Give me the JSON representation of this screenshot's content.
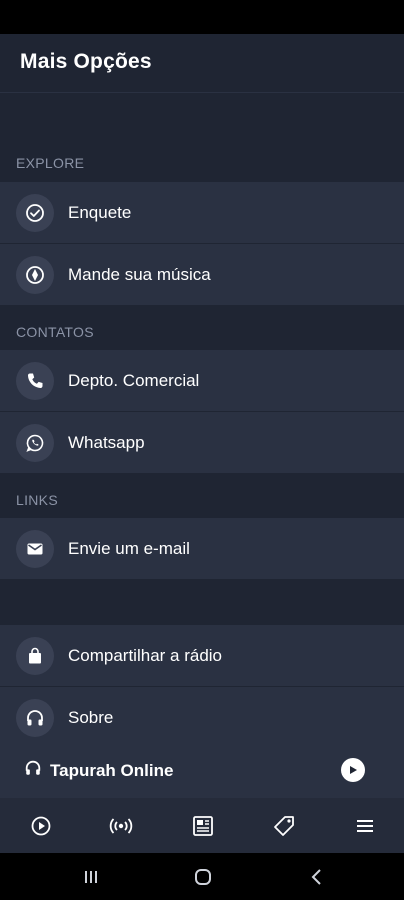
{
  "header": {
    "title": "Mais Opções"
  },
  "sections": {
    "explore": "EXPLORE",
    "contatos": "CONTATOS",
    "links": "LINKS"
  },
  "items": {
    "enquete": "Enquete",
    "mande_musica": "Mande sua música",
    "comercial": "Depto. Comercial",
    "whatsapp": "Whatsapp",
    "email": "Envie um e-mail",
    "compartilhar": "Compartilhar a rádio",
    "sobre": "Sobre"
  },
  "player": {
    "title": "Tapurah Online"
  },
  "tabs": {
    "icons": [
      "play-circle-icon",
      "broadcast-icon",
      "newspaper-icon",
      "tag-icon",
      "menu-icon"
    ]
  },
  "colors": {
    "background": "#1f2533",
    "row": "#2a3142",
    "icon_circle": "#3a4154",
    "section_text": "#8b93a6"
  }
}
